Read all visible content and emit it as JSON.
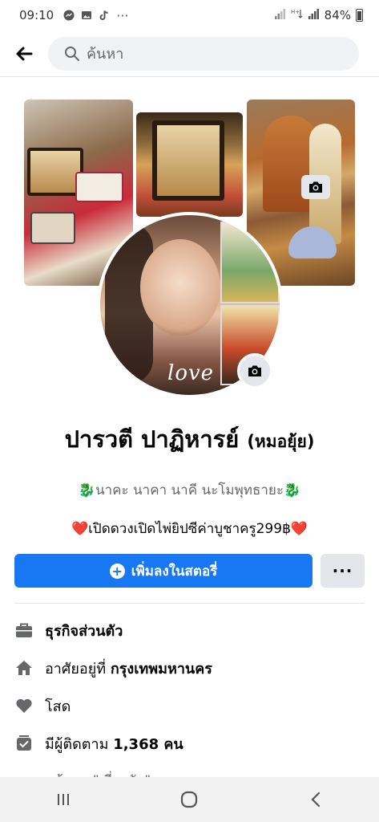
{
  "status_bar": {
    "time": "09:10",
    "battery": "84%",
    "dots": "···"
  },
  "search": {
    "placeholder": "ค้นหา"
  },
  "profile": {
    "name": "ปารวตี ปาฏิหารย์",
    "alt_name": "(หมอยุ้ย)",
    "avatar_text": "love",
    "bio_line1": "🐉นาคะ นาคา นาคี นะโมพุทธายะ🐉",
    "bio_line2": "❤️เปิดดวงเปิดไพ่ยิปซีค่าบูชาครู299฿❤️"
  },
  "actions": {
    "add_story_label": "เพิ่มลงในสตอรี่",
    "add_story_plus": "+",
    "more_label": "···"
  },
  "details": {
    "work": "ธุรกิจส่วนตัว",
    "lives_prefix": "อาศัยอยู่ที่ ",
    "lives_city": "กรุงเทพมหานคร",
    "relationship": "โสด",
    "followers_prefix": "มีผู้ติดตาม ",
    "followers_count": "1,368 คน",
    "partial_row": "ดูข้อมูล \"เกี่ยวกับ\" ของคุณ"
  },
  "colors": {
    "accent": "#1877f2",
    "secondary_button": "#e4e6eb",
    "muted_text": "#65676b"
  },
  "icons": {
    "back": "arrow-left-icon",
    "search": "search-icon",
    "cover_camera": "camera-icon",
    "avatar_camera": "camera-icon",
    "work": "briefcase-icon",
    "home": "home-icon",
    "heart": "heart-icon",
    "followers": "followers-icon",
    "nav_recents": "recents-icon",
    "nav_home": "home-circle-icon",
    "nav_back": "chevron-left-icon"
  }
}
